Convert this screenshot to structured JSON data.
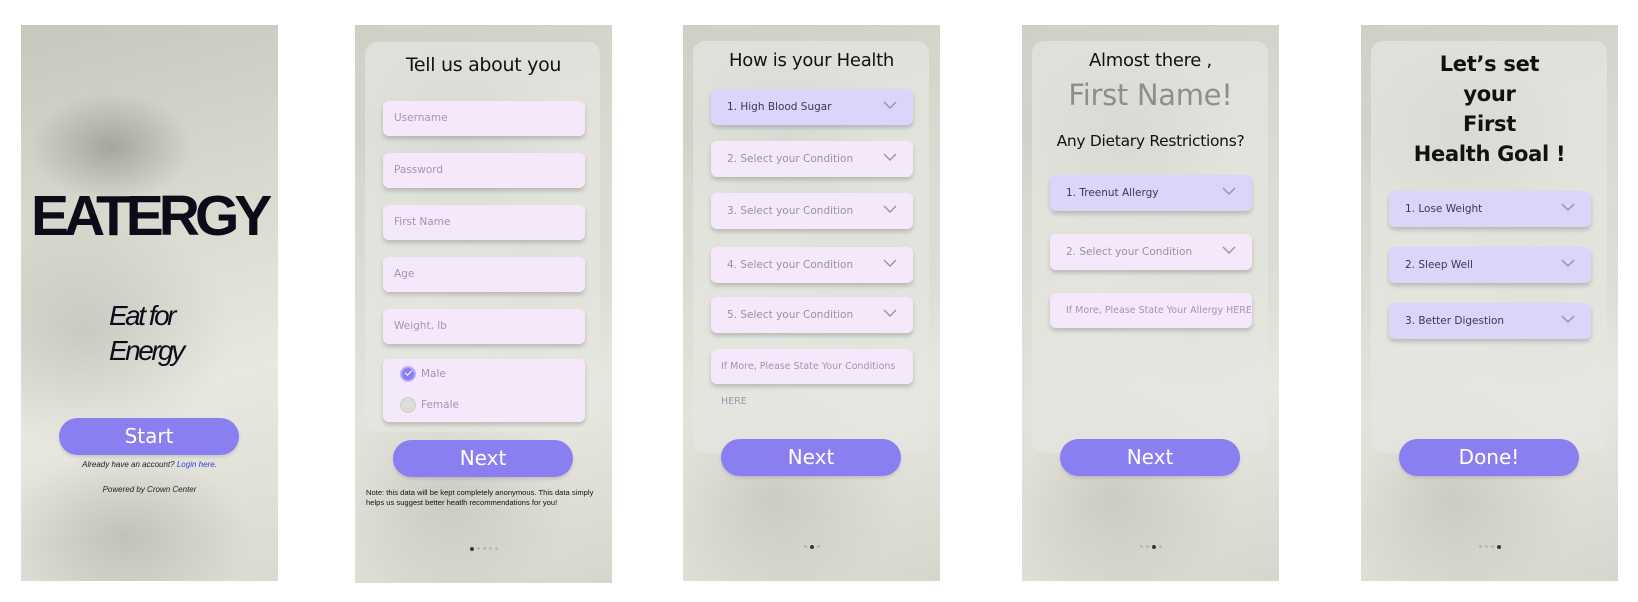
{
  "screen_welcome": {
    "logo": "EATERGY",
    "tagline_line1": "Eat for",
    "tagline_line2": "Energy",
    "start_label": "Start",
    "account_prompt": "Already have an account? ",
    "login_link": "Login here.",
    "powered_by": "Powered by Crown Center"
  },
  "screen_about": {
    "title": "Tell us about you",
    "username_placeholder": "Username",
    "password_placeholder": "Password",
    "first_name_placeholder": "First Name",
    "age_placeholder": "Age",
    "weight_placeholder": "Weight, lb",
    "gender_options": [
      "Male",
      "Female"
    ],
    "selected_gender": "Male",
    "next_label": "Next",
    "note": "Note: this data will be kept completely anonymous. This data simply  helps us suggest better heatlh recommendations for you!",
    "page_index": 1,
    "page_count": 5
  },
  "screen_health": {
    "title": "How is your Health",
    "conditions": [
      "1. High Blood Sugar",
      "2. Select your Condition",
      "3. Select your Condition",
      "4. Select your Condition",
      "5. Select your Condition"
    ],
    "more_placeholder": "If More, Please State Your Conditions HERE",
    "next_label": "Next",
    "page_index": 2,
    "page_count": 3
  },
  "screen_diet": {
    "title_line1": "Almost there ,",
    "name_placeholder": "First Name!",
    "subtitle": "Any Dietary Restrictions?",
    "restrictions": [
      "1. Treenut Allergy",
      "2. Select your Condition"
    ],
    "more_placeholder": "If More, Please State Your Allergy HERE",
    "next_label": "Next",
    "page_index": 3,
    "page_count": 4
  },
  "screen_goal": {
    "title_lines": [
      "Let’s set",
      "your",
      "First",
      "Health Goal !"
    ],
    "goals": [
      "1. Lose Weight",
      "2. Sleep Well",
      "3. Better Digestion"
    ],
    "done_label": "Done!",
    "page_index": 4,
    "page_count": 4
  },
  "colors": {
    "accent": "#8a7ff0",
    "field_bg": "#f6e8fb",
    "selected_field_bg": "#dcd5fb",
    "link": "#2e3fd8"
  },
  "icons": [
    "chevron-down-icon",
    "checkmark-icon"
  ]
}
